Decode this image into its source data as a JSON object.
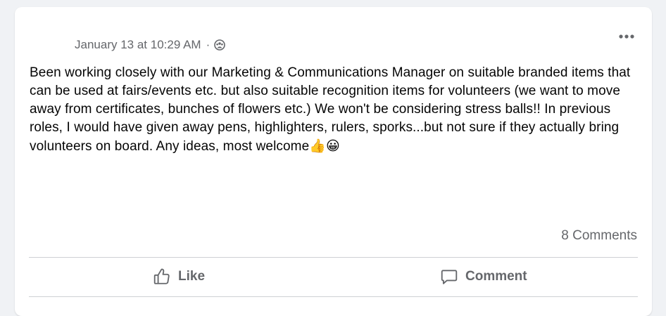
{
  "post": {
    "timestamp": "January 13 at 10:29 AM",
    "separator": "·",
    "privacy_icon": "group-privacy-icon",
    "more_icon": "more-options-icon",
    "text": "Been working closely with our Marketing & Communications Manager on suitable branded items that can be used at fairs/events etc. but also suitable recognition items for volunteers (we want to move away from certificates, bunches of flowers etc.) We won't be considering stress balls!! In previous roles, I would have given away pens, highlighters, rulers, sporks...but not sure if they actually bring volunteers on board. Any ideas, most welcome",
    "emojis": [
      "👍",
      "😀"
    ]
  },
  "footer": {
    "comments_count": "8 Comments"
  },
  "actions": {
    "like_label": "Like",
    "comment_label": "Comment"
  },
  "colors": {
    "card_bg": "#ffffff",
    "page_bg": "#f0f2f5",
    "secondary_text": "#65676b",
    "primary_text": "#050505",
    "divider": "#ced0d4"
  }
}
